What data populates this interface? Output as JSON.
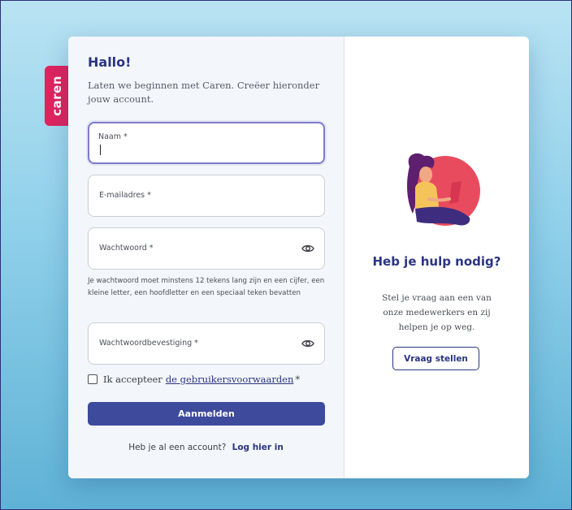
{
  "brand": {
    "tab_label": "caren",
    "color": "#e0245e"
  },
  "form": {
    "title": "Hallo!",
    "subtitle": "Laten we beginnen met Caren. Creëer hieronder jouw account.",
    "fields": {
      "name": {
        "label": "Naam *",
        "value": ""
      },
      "email": {
        "label": "E-mailadres *",
        "value": ""
      },
      "password": {
        "label": "Wachtwoord *",
        "value": ""
      },
      "password_confirm": {
        "label": "Wachtwoordbevestiging *",
        "value": ""
      }
    },
    "password_hint": "Je wachtwoord moet minstens 12 tekens lang zijn en een cijfer, een kleine letter, een hoofdletter en een speciaal teken bevatten",
    "terms": {
      "prefix": "Ik accepteer",
      "link": "de gebruikersvoorwaarden",
      "suffix": "*",
      "checked": false
    },
    "submit_label": "Aanmelden",
    "login": {
      "prompt": "Heb je al een account?",
      "link": "Log hier in"
    }
  },
  "help": {
    "title": "Heb je hulp nodig?",
    "text": "Stel je vraag aan een van onze medewerkers en zij helpen je op weg.",
    "button_label": "Vraag stellen"
  },
  "colors": {
    "primary": "#3e4a9b",
    "heading": "#2a3580",
    "focus": "#7d7bc9"
  },
  "icons": {
    "password_toggle": "eye-icon",
    "illustration": "woman-with-laptop-illustration"
  }
}
